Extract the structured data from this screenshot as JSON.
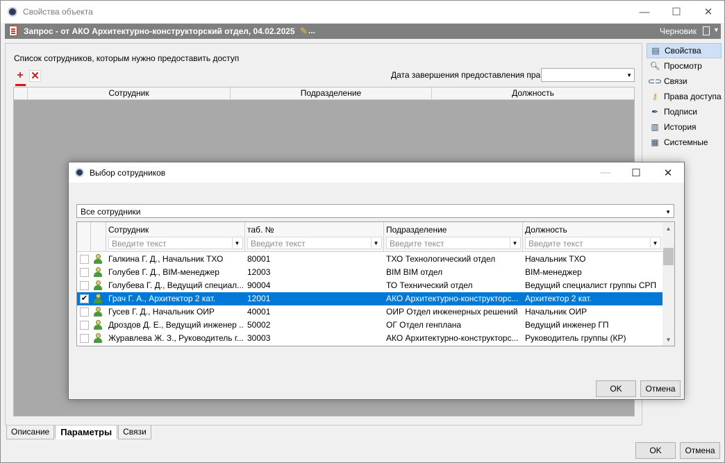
{
  "window": {
    "title": "Свойства объекта",
    "minimize": "—",
    "maximize": "☐",
    "close": "✕"
  },
  "docbar": {
    "title": "Запрос - от АКО Архитектурно-конструкторский отдел, 04.02.2025",
    "more": "...",
    "status": "Черновик"
  },
  "panel": {
    "list_label": "Список сотрудников, которым нужно предоставить доступ",
    "add_icon": "add-icon",
    "delete_icon": "delete-icon",
    "date_label": "Дата завершения предоставления прав",
    "date_value": "",
    "columns": [
      "Сотрудник",
      "Подразделение",
      "Должность"
    ]
  },
  "tabs": [
    {
      "label": "Описание",
      "active": false
    },
    {
      "label": "Параметры",
      "active": true
    },
    {
      "label": "Связи",
      "active": false
    }
  ],
  "sidebar": {
    "items": [
      {
        "label": "Свойства",
        "icon": "properties-icon",
        "active": true
      },
      {
        "label": "Просмотр",
        "icon": "magnifier-icon",
        "active": false
      },
      {
        "label": "Связи",
        "icon": "link-icon",
        "active": false
      },
      {
        "label": "Права доступа",
        "icon": "key-icon",
        "active": false
      },
      {
        "label": "Подписи",
        "icon": "pen-icon",
        "active": false
      },
      {
        "label": "История",
        "icon": "books-icon",
        "active": false
      },
      {
        "label": "Системные",
        "icon": "system-icon",
        "active": false
      }
    ]
  },
  "footer": {
    "ok": "OK",
    "cancel": "Отмена"
  },
  "dialog": {
    "title": "Выбор сотрудников",
    "filter_value": "Все сотрудники",
    "columns": [
      {
        "label": "Сотрудник",
        "placeholder": "Введите текст"
      },
      {
        "label": "таб. №",
        "placeholder": "Введите текст"
      },
      {
        "label": "Подразделение",
        "placeholder": "Введите текст"
      },
      {
        "label": "Должность",
        "placeholder": "Введите текст"
      }
    ],
    "rows": [
      {
        "checked": false,
        "name": "Галкина Г. Д., Начальник ТХО",
        "tab": "80001",
        "dept": "ТХО Технологический отдел",
        "pos": "Начальник ТХО",
        "selected": false
      },
      {
        "checked": false,
        "name": "Голубев Г. Д., BIM-менеджер",
        "tab": "12003",
        "dept": "BIM BIM отдел",
        "pos": "BIM-менеджер",
        "selected": false
      },
      {
        "checked": false,
        "name": "Голубева Г. Д., Ведущий специал...",
        "tab": "90004",
        "dept": "ТО Технический отдел",
        "pos": "Ведущий специалист группы СРП",
        "selected": false
      },
      {
        "checked": true,
        "name": "Грач Г. А., Архитектор 2 кат.",
        "tab": "12001",
        "dept": "АКО Архитектурно-конструкторс...",
        "pos": "Архитектор 2 кат.",
        "selected": true
      },
      {
        "checked": false,
        "name": "Гусев Г. Д., Начальник ОИР",
        "tab": "40001",
        "dept": "ОИР Отдел инженерных решений",
        "pos": "Начальник ОИР",
        "selected": false
      },
      {
        "checked": false,
        "name": "Дроздов Д. Е., Ведущий инженер ...",
        "tab": "50002",
        "dept": "ОГ Отдел генплана",
        "pos": "Ведущий инженер ГП",
        "selected": false
      },
      {
        "checked": false,
        "name": "Журавлева Ж. З., Руководитель г...",
        "tab": "30003",
        "dept": "АКО Архитектурно-конструкторс...",
        "pos": "Руководитель группы (КР)",
        "selected": false
      }
    ],
    "ok": "OK",
    "cancel": "Отмена"
  },
  "colors": {
    "selection": "#0078d7",
    "docbar": "#7f7f7f",
    "grid_bg": "#a9a9a9"
  }
}
